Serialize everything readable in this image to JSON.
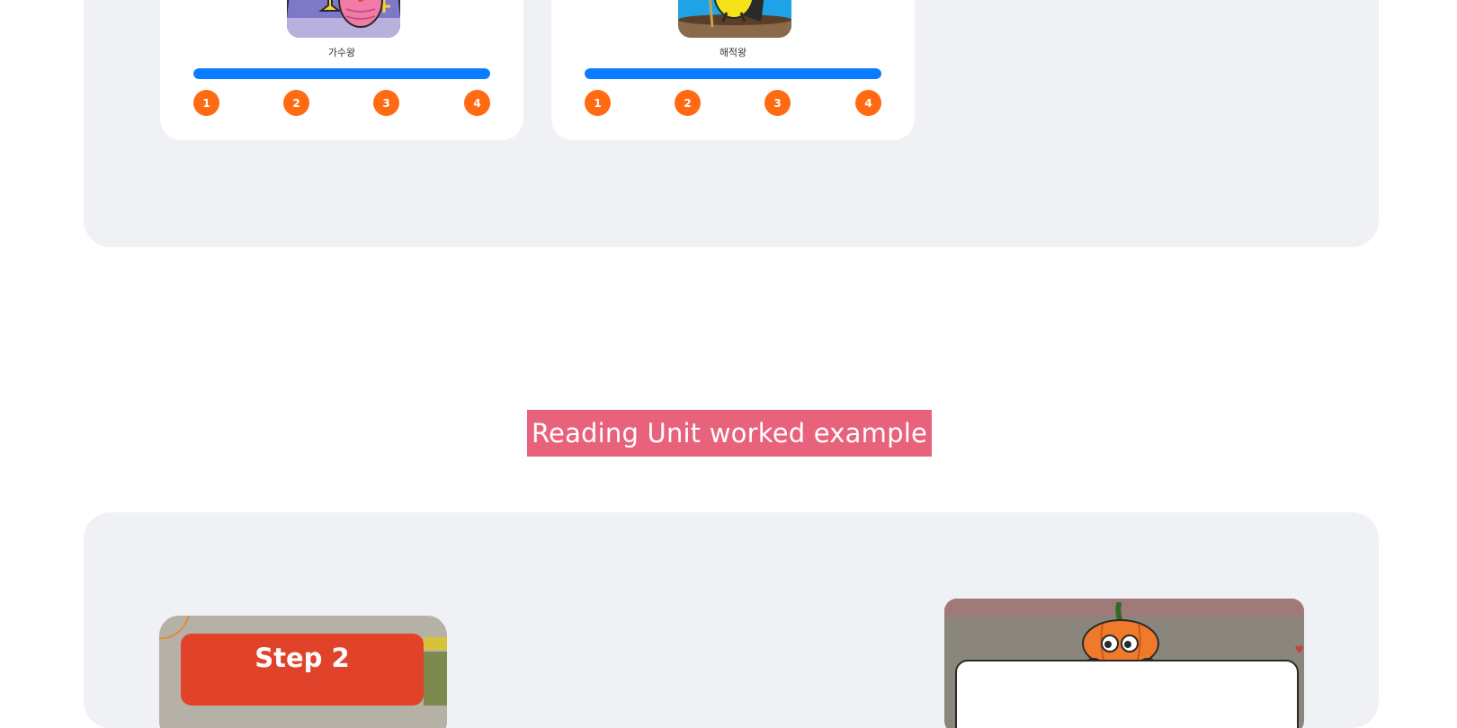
{
  "cards": [
    {
      "label": "가수왕",
      "progress": 1.0,
      "steps": [
        "1",
        "2",
        "3",
        "4"
      ],
      "accent": "#0a7cff"
    },
    {
      "label": "해적왕",
      "progress": 1.0,
      "steps": [
        "1",
        "2",
        "3",
        "4"
      ],
      "accent": "#0a7cff"
    }
  ],
  "step_color": "#ff6a13",
  "section": {
    "title": "Reading Unit worked example",
    "color": "#e8627b"
  },
  "examples": {
    "left": {
      "banner": "Step 2",
      "banner_color": "#e0432a"
    },
    "right": {
      "icon": "pumpkin-character-icon"
    }
  }
}
